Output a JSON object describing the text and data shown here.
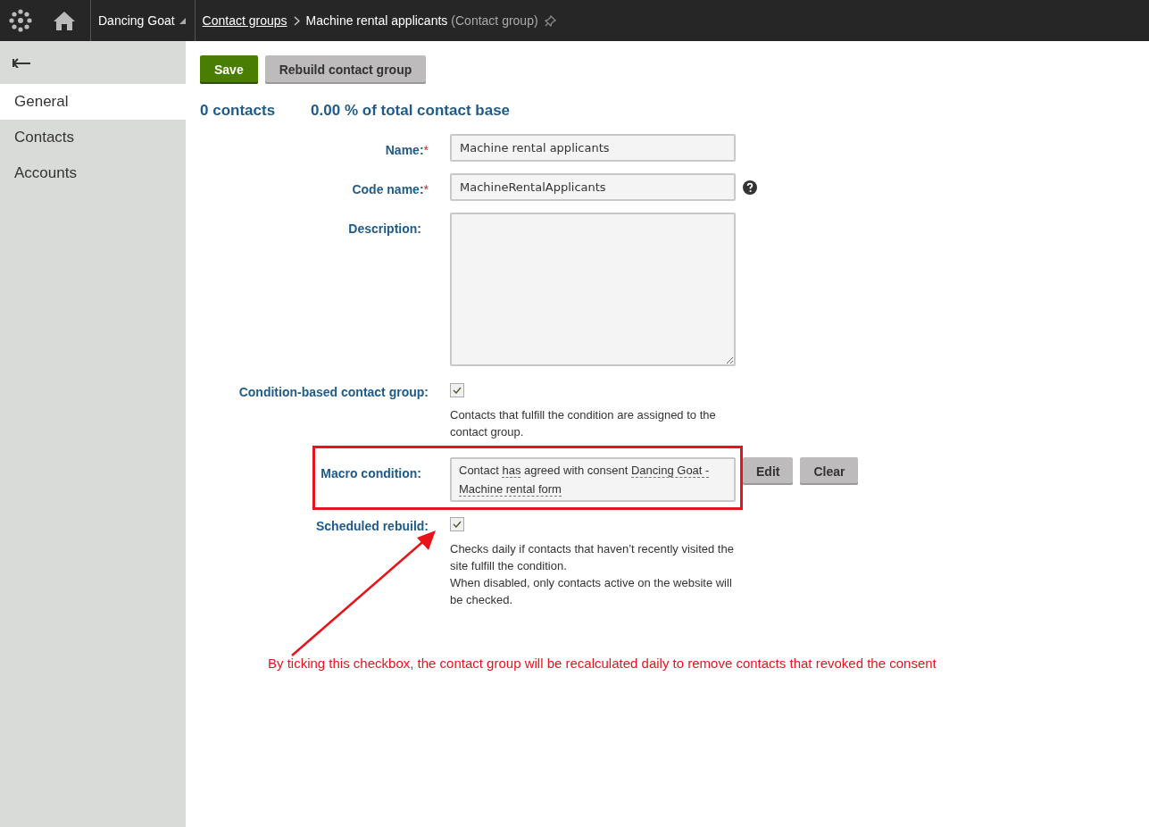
{
  "header": {
    "site": "Dancing Goat",
    "breadcrumb": {
      "link": "Contact groups",
      "current": "Machine rental applicants",
      "type": "(Contact group)"
    }
  },
  "sidebar": {
    "items": [
      {
        "label": "General",
        "selected": true
      },
      {
        "label": "Contacts",
        "selected": false
      },
      {
        "label": "Accounts",
        "selected": false
      }
    ]
  },
  "toolbar": {
    "buttons": [
      {
        "label": "Save",
        "kind": "primary"
      },
      {
        "label": "Rebuild contact group",
        "kind": "secondary"
      }
    ]
  },
  "stats": [
    "0 contacts",
    "0.00 % of total contact base"
  ],
  "form": [
    {
      "kind": "text",
      "label": "Name:",
      "required_mark": "*",
      "value": "Machine rental applicants"
    },
    {
      "kind": "text",
      "label": "Code name:",
      "required_mark": "*",
      "value": "MachineRentalApplicants",
      "help": true
    },
    {
      "kind": "textarea",
      "label": "Description:"
    },
    {
      "kind": "checkbox",
      "label": "Condition-based contact group:",
      "checked": true,
      "notes": [
        "Contacts that fulfill the condition are assigned to the contact group."
      ]
    },
    {
      "kind": "macro",
      "label": "Macro condition:",
      "highlighted": true,
      "segments": [
        {
          "text": "Contact ",
          "kind": "plain"
        },
        {
          "text": "has",
          "kind": "param"
        },
        {
          "text": " agreed with consent ",
          "kind": "plain"
        },
        {
          "text": "Dancing Goat - Machine rental form",
          "kind": "param"
        }
      ],
      "buttons": [
        "Edit",
        "Clear"
      ]
    },
    {
      "kind": "checkbox",
      "label": "Scheduled rebuild:",
      "checked": true,
      "notes": [
        "Checks daily if contacts that haven’t recently visited the site fulfill the condition.",
        "When disabled, only contacts active on the website will be checked."
      ]
    }
  ],
  "annotation": "By ticking this checkbox, the contact group will be recalculated daily to remove contacts that revoked the consent"
}
